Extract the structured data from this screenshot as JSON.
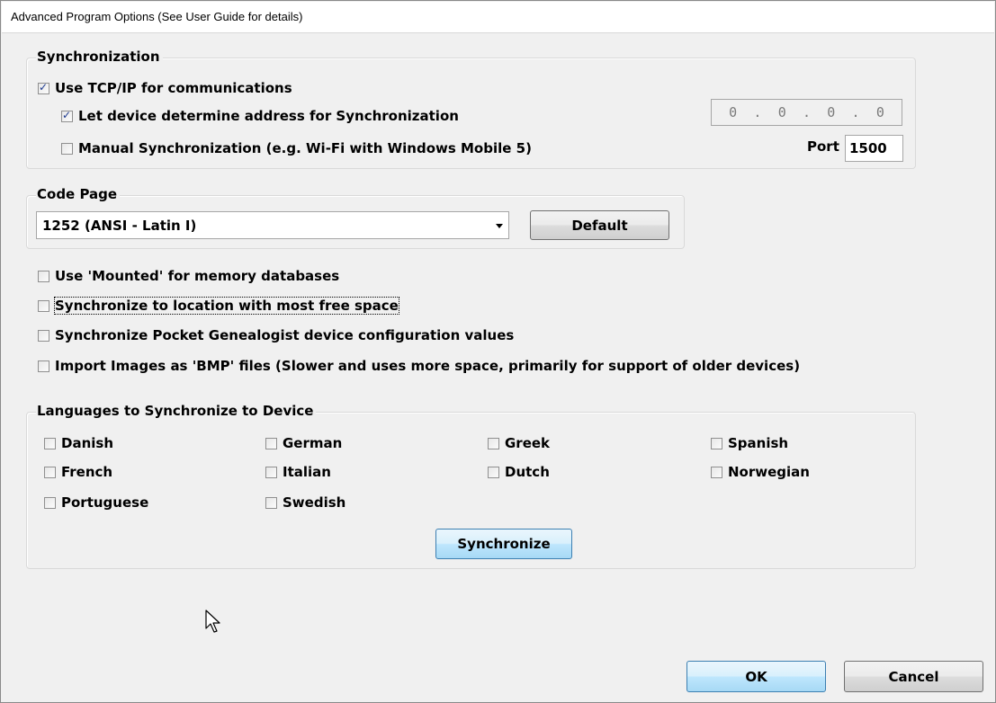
{
  "window": {
    "title": "Advanced Program Options (See User Guide for details)"
  },
  "sync": {
    "legend": "Synchronization",
    "use_tcpip": {
      "label": "Use TCP/IP for communications",
      "checked": true
    },
    "let_device": {
      "label": "Let device determine address for Synchronization",
      "checked": true
    },
    "manual": {
      "label": "Manual Synchronization (e.g. Wi-Fi with Windows Mobile 5)",
      "checked": false
    },
    "ip": [
      "0",
      "0",
      "0",
      "0"
    ],
    "ip_sep": ".",
    "port_label": "Port",
    "port_value": "1500"
  },
  "code_page": {
    "legend": "Code Page",
    "selected": "1252  (ANSI - Latin I)",
    "default_button": "Default"
  },
  "options": [
    {
      "label": "Use 'Mounted' for memory databases",
      "checked": false
    },
    {
      "label": "Synchronize to location with most free space",
      "checked": false
    },
    {
      "label": "Synchronize Pocket Genealogist device configuration values",
      "checked": false
    },
    {
      "label": "Import Images as 'BMP' files (Slower and uses more space, primarily for support of older devices)",
      "checked": false
    }
  ],
  "languages": {
    "legend": "Languages to Synchronize to Device",
    "items": [
      "Danish",
      "German",
      "Greek",
      "Spanish",
      "French",
      "Italian",
      "Dutch",
      "Norwegian",
      "Portuguese",
      "Swedish"
    ],
    "sync_button": "Synchronize"
  },
  "footer": {
    "ok": "OK",
    "cancel": "Cancel"
  }
}
